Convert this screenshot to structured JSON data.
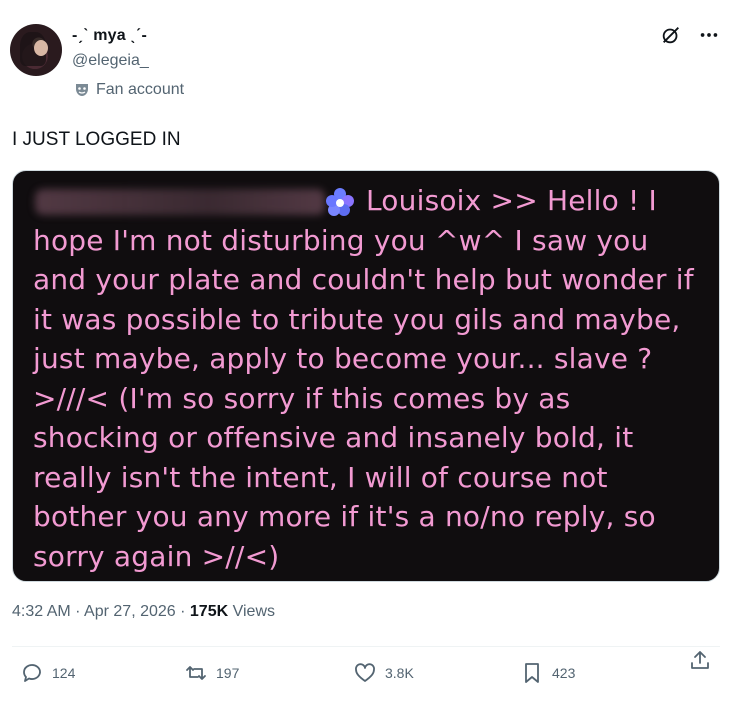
{
  "user": {
    "display_name": "-ˏˋ mya ˎˊ-",
    "handle": "@elegeia_",
    "badge": "Fan account"
  },
  "tweet": {
    "text": "I JUST LOGGED IN",
    "image_text": "Louisoix >> Hello ! I hope I'm not disturbing you ^w^ I saw you and your plate and couldn't help but wonder if it was possible to tribute you gils and maybe, just maybe, apply to become your... slave ? >///< (I'm so sorry if this comes by as shocking or offensive and insanely bold, it really isn't the intent, I will of course not bother you any more if it's a no/no reply, so sorry again >//<)"
  },
  "meta": {
    "time": "4:32 AM",
    "date": "Apr 27, 2026",
    "views_count": "175K",
    "views_label": "Views"
  },
  "actions": {
    "replies": "124",
    "reposts": "197",
    "likes": "3.8K",
    "bookmarks": "423"
  },
  "colors": {
    "text_muted": "#536471",
    "image_text": "#f29ad2",
    "image_bg": "#100d0f"
  }
}
